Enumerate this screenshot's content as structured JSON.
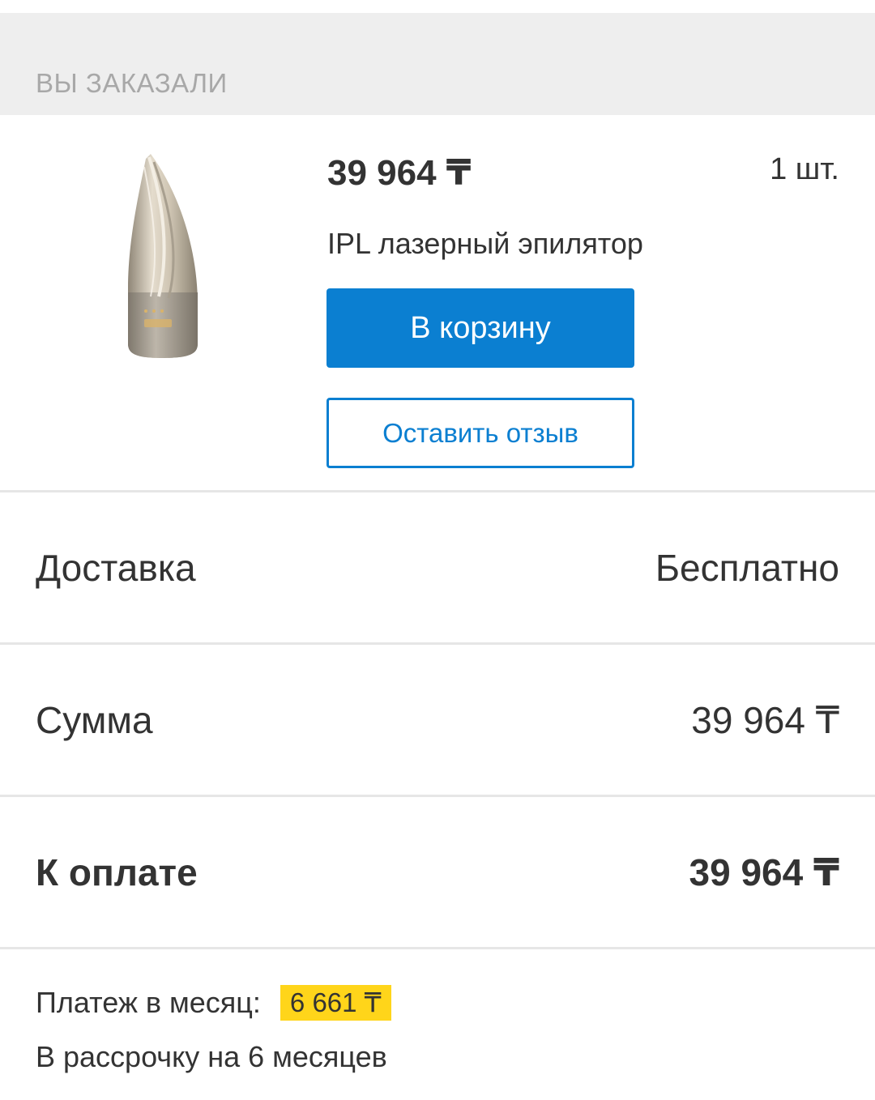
{
  "section": {
    "title": "ВЫ ЗАКАЗАЛИ"
  },
  "product": {
    "price": "39 964 ₸",
    "quantity": "1 шт.",
    "title": "IPL лазерный эпилятор",
    "image_icon": "ipl-epilator-product-icon",
    "add_to_cart_label": "В корзину",
    "review_label": "Оставить отзыв"
  },
  "summary": {
    "delivery_label": "Доставка",
    "delivery_value": "Бесплатно",
    "sum_label": "Сумма",
    "sum_value": "39 964 ₸",
    "total_label": "К оплате",
    "total_value": "39 964 ₸"
  },
  "installment": {
    "monthly_label": "Платеж в месяц:",
    "monthly_value": "6 661 ₸",
    "term_text": "В рассрочку на 6 месяцев"
  },
  "colors": {
    "accent": "#0b7fd1",
    "badge": "#ffd51a",
    "header_bg": "#eeeeee"
  }
}
